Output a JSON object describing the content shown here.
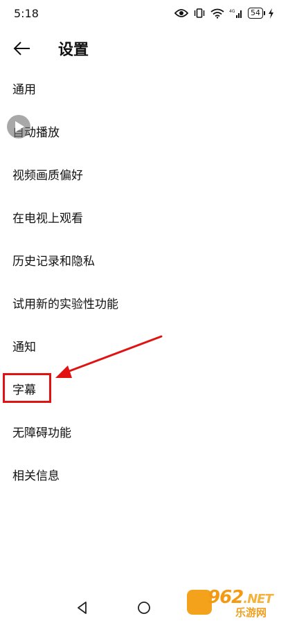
{
  "status_bar": {
    "time": "5:18",
    "battery_level": "54",
    "icons": [
      "eye-icon",
      "vibrate-icon",
      "wifi-icon",
      "signal-4g-icon",
      "battery-icon",
      "charging-icon"
    ]
  },
  "appbar": {
    "back_icon": "arrow-left-icon",
    "title": "设置"
  },
  "menu": {
    "items": [
      {
        "label": "通用"
      },
      {
        "label": "自动播放"
      },
      {
        "label": "视频画质偏好"
      },
      {
        "label": "在电视上观看"
      },
      {
        "label": "历史记录和隐私"
      },
      {
        "label": "试用新的实验性功能"
      },
      {
        "label": "通知"
      },
      {
        "label": "字幕"
      },
      {
        "label": "无障碍功能"
      },
      {
        "label": "相关信息"
      }
    ]
  },
  "annotation": {
    "highlighted_item": "字幕",
    "color": "#e01212"
  },
  "nav_bar": {
    "icons": [
      "nav-back-icon",
      "nav-home-icon"
    ]
  },
  "watermark": {
    "brand": "962",
    "brand_suffix": ".NET",
    "site": "乐游网",
    "color": "#f39a12"
  }
}
